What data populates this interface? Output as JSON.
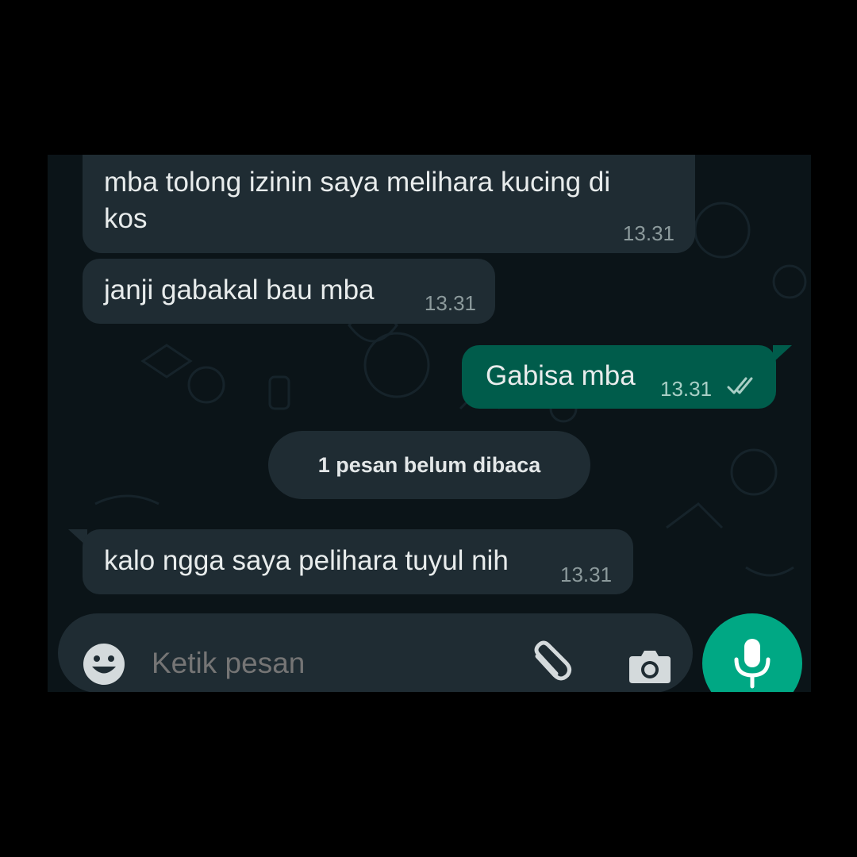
{
  "messages": [
    {
      "text_line1": "mba tolong izinin saya melihara kucing di",
      "text_line2": "kos",
      "time": "13.31",
      "direction": "incoming"
    },
    {
      "text": "janji gabakal bau mba",
      "time": "13.31",
      "direction": "incoming"
    },
    {
      "text": "Gabisa mba",
      "time": "13.31",
      "direction": "outgoing",
      "status": "read-ticks-icon"
    },
    {
      "text": "kalo ngga saya pelihara tuyul nih",
      "time": "13.31",
      "direction": "incoming"
    }
  ],
  "unread_banner": "1 pesan belum dibaca",
  "composer": {
    "placeholder": "Ketik pesan"
  },
  "icons": [
    "emoji-icon",
    "attach-icon",
    "camera-icon",
    "mic-icon"
  ],
  "colors": {
    "background": "#0b1418",
    "incoming": "#1f2c33",
    "outgoing": "#005c4b",
    "accent": "#00a884"
  }
}
